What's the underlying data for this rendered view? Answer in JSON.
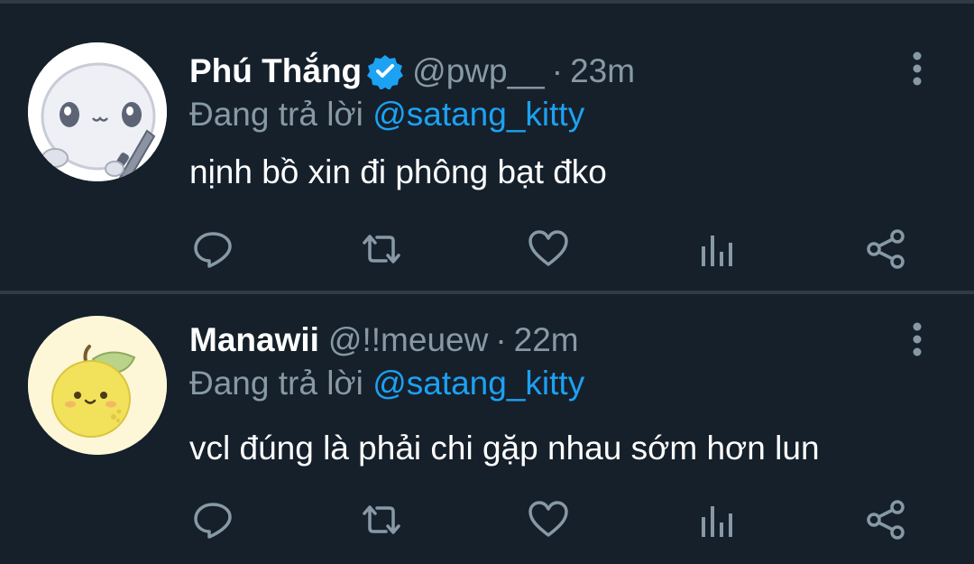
{
  "tweets": [
    {
      "name": "Phú Thắng",
      "verified": true,
      "handle": "@pwp__",
      "separator": "·",
      "time": "23m",
      "reply_prefix": "Đang trả lời",
      "reply_to": "@satang_kitty",
      "text": "nịnh bồ xin đi phông bạt đko",
      "avatar_icon": "ghost-knife-avatar"
    },
    {
      "name": "Manawii",
      "verified": false,
      "handle": "@!!meuew",
      "separator": "·",
      "time": "22m",
      "reply_prefix": "Đang trả lời",
      "reply_to": "@satang_kitty",
      "text": "vcl đúng là phải chi gặp nhau sớm hơn lun",
      "avatar_icon": "lemon-avatar"
    }
  ],
  "icons": {
    "reply": "reply-icon",
    "retweet": "retweet-icon",
    "like": "heart-icon",
    "stats": "analytics-icon",
    "share": "share-icon",
    "more": "more-vertical-icon",
    "verified": "verified-badge-icon"
  },
  "colors": {
    "background": "#15202b",
    "divider": "#2f3a45",
    "text_primary": "#ffffff",
    "text_secondary": "#8899a6",
    "accent": "#1da1f2"
  }
}
